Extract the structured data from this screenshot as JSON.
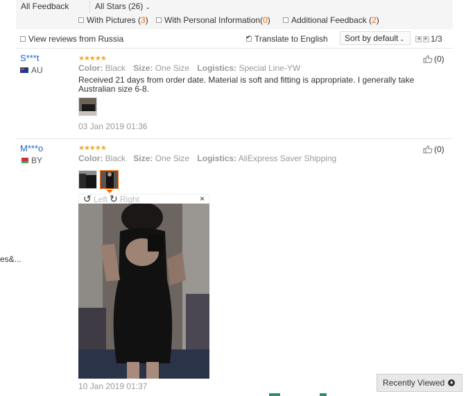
{
  "topbar": {
    "all_feedback": "All Feedback",
    "all_stars": "All Stars (26)",
    "filters": [
      {
        "label": "With Pictures (",
        "count": "3",
        "close": ")"
      },
      {
        "label": "With Personal Information(",
        "count": "0",
        "close": ")"
      },
      {
        "label": "Additional Feedback (",
        "count": "2",
        "close": ")"
      }
    ]
  },
  "options": {
    "view_russia": "View reviews from Russia",
    "translate": "Translate to English",
    "sort": "Sort by default",
    "page": "1/3"
  },
  "reviews": [
    {
      "user": "S***t",
      "country": "AU",
      "stars": "★★★★★",
      "color_key": "Color:",
      "color": "Black",
      "size_key": "Size:",
      "size": "One Size",
      "logistics_key": "Logistics:",
      "logistics": "Special Line-YW",
      "text": "Received 21 days from order date. Material is soft and fitting is appropriate. I generally take Australian size 6-8.",
      "date": "03 Jan 2019 01:36",
      "helpful": "(0)"
    },
    {
      "user": "M***o",
      "country": "BY",
      "stars": "★★★★★",
      "color_key": "Color:",
      "color": "Black",
      "size_key": "Size:",
      "size": "One Size",
      "logistics_key": "Logistics:",
      "logistics": "AliExpress Saver Shipping",
      "date": "10 Jan 2019 01:37",
      "helpful": "(0)"
    }
  ],
  "viewer": {
    "left": "Left",
    "right": "Right",
    "close": "×"
  },
  "left_cut_text": "es&...",
  "recently_viewed": "Recently Viewed",
  "colors": {
    "accent": "#ff6600",
    "link": "#2263d9",
    "star": "#f5a623"
  }
}
